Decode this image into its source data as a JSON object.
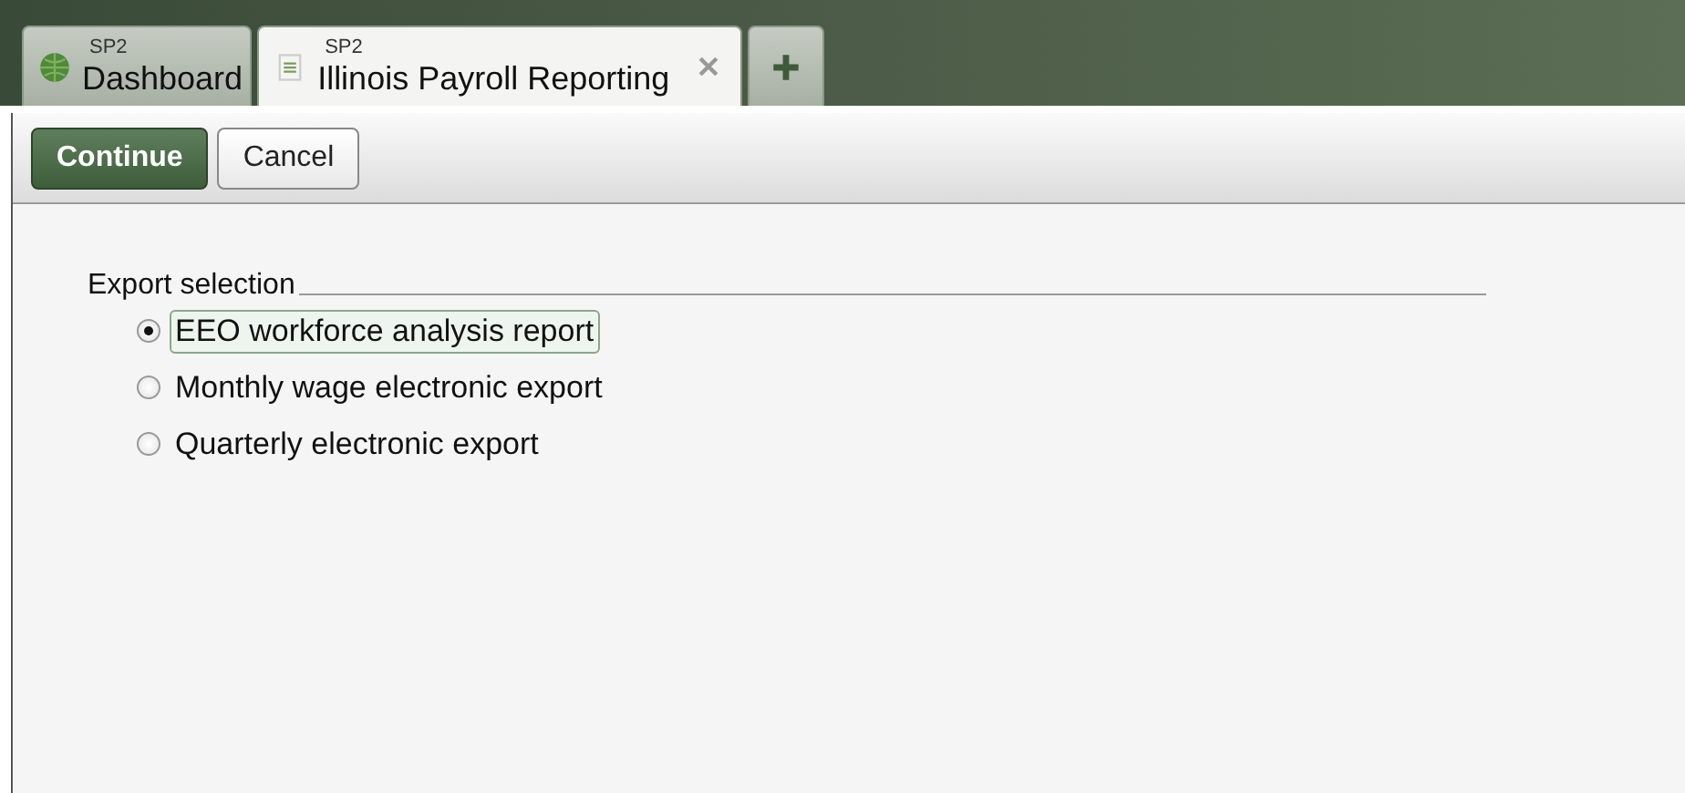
{
  "tabs": [
    {
      "kind": "dashboard",
      "caption": "SP2",
      "label": "Dashboard",
      "selected": false
    },
    {
      "kind": "document",
      "caption": "SP2",
      "label": "Illinois Payroll Reporting",
      "selected": true
    }
  ],
  "toolbar": {
    "buttons": [
      {
        "label": "Continue",
        "primary": true
      },
      {
        "label": "Cancel",
        "primary": false
      }
    ]
  },
  "export_selection": {
    "legend": "Export selection",
    "options": [
      {
        "label": "EEO workforce analysis report",
        "selected": true
      },
      {
        "label": "Monthly wage electronic export",
        "selected": false
      },
      {
        "label": "Quarterly electronic export",
        "selected": false
      }
    ]
  }
}
